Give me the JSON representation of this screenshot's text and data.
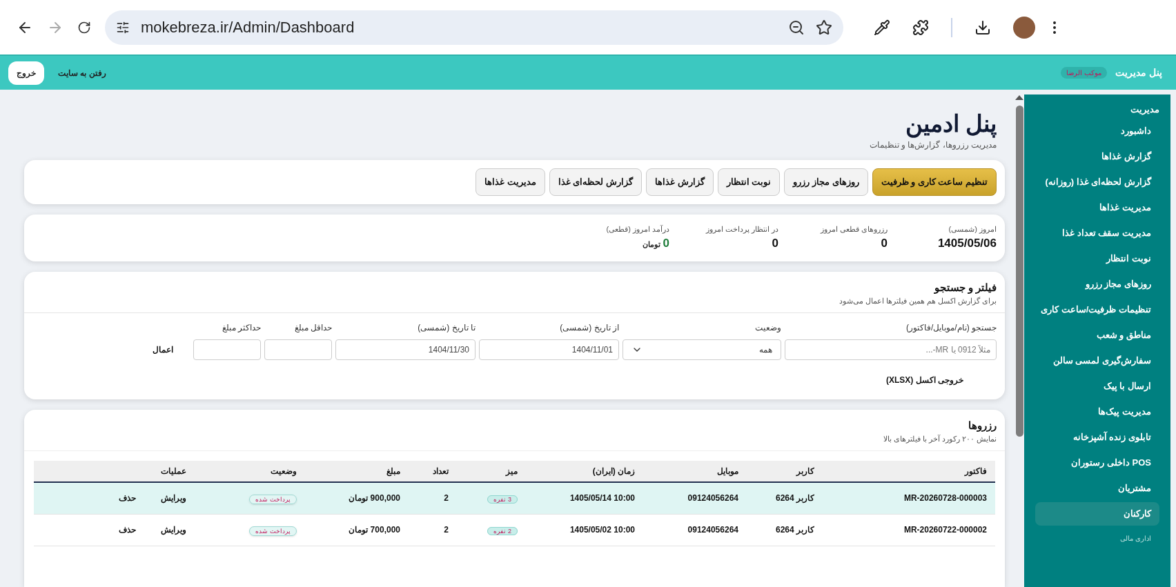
{
  "browser": {
    "url": "mokebreza.ir/Admin/Dashboard"
  },
  "topbar": {
    "title": "پنل مدیریت",
    "badge": "موکب الرضا",
    "site_link": "رفتن به سایت",
    "logout": "خروج"
  },
  "page": {
    "title": "پنل ادمین",
    "subtitle": "مدیریت رزروها، گزارش‌ها و تنظیمات"
  },
  "tabs": [
    {
      "label": "تنظیم ساعت کاری و ظرفیت",
      "selected": true
    },
    {
      "label": "روزهای مجاز رزرو",
      "selected": false
    },
    {
      "label": "نوبت انتظار",
      "selected": false
    },
    {
      "label": "گزارش غذاها",
      "selected": false
    },
    {
      "label": "گزارش لحظه‌ای غذا",
      "selected": false
    },
    {
      "label": "مدیریت غذاها",
      "selected": false
    }
  ],
  "stats": [
    {
      "label": "امروز (شمسی)",
      "value": "1405/05/06",
      "kind": "plain"
    },
    {
      "label": "رزروهای قطعی امروز",
      "value": "0",
      "kind": "plain"
    },
    {
      "label": "در انتظار پرداخت امروز",
      "value": "0",
      "kind": "plain"
    },
    {
      "label": "درآمد امروز (قطعی)",
      "value": "0",
      "unit": "تومان",
      "kind": "money"
    }
  ],
  "filter": {
    "title": "فیلتر و جستجو",
    "subtitle": "برای گزارش اکسل هم همین فیلترها اعمال می‌شود",
    "fields": [
      {
        "label": "جستجو (نام/موبایل/فاکتور)",
        "placeholder": "مثلاً 0912 یا MR-...",
        "kind": "text"
      },
      {
        "label": "وضعیت",
        "value": "همه",
        "kind": "select"
      },
      {
        "label": "از تاریخ (شمسی)",
        "value": "1404/11/01",
        "kind": "text"
      },
      {
        "label": "تا تاریخ (شمسی)",
        "value": "1404/11/30",
        "kind": "text"
      },
      {
        "label": "حداقل مبلغ",
        "kind": "small"
      },
      {
        "label": "حداکثر مبلغ",
        "kind": "small"
      }
    ],
    "apply": "اعمال",
    "export": "خروجی اکسل (XLSX)"
  },
  "reservations": {
    "title": "رزروها",
    "subtitle": "نمایش ۲۰۰ رکورد آخر با فیلترهای بالا",
    "columns": [
      "فاکتور",
      "کاربر",
      "موبایل",
      "زمان (ایران)",
      "میز",
      "تعداد",
      "مبلغ",
      "وضعیت",
      "عملیات"
    ],
    "rows": [
      {
        "selected": true,
        "invoice": "MR-20260728-000003",
        "user": "کاربر 6264",
        "mobile": "09124056264",
        "time": "10:00 1405/05/14",
        "table": "3 نفره",
        "count": "2",
        "amount": "900,000 تومان",
        "status": "پرداخت شده",
        "edit": "ویرایش",
        "delete": "حذف"
      },
      {
        "selected": false,
        "invoice": "MR-20260722-000002",
        "user": "کاربر 6264",
        "mobile": "09124056264",
        "time": "10:00 1405/05/02",
        "table": "2 نفره",
        "count": "2",
        "amount": "700,000 تومان",
        "status": "پرداخت شده",
        "edit": "ویرایش",
        "delete": "حذف"
      }
    ]
  },
  "sidebar": {
    "title": "مدیریت",
    "items": [
      {
        "label": "داشبورد",
        "selected": false
      },
      {
        "label": "گزارش غذاها",
        "selected": false
      },
      {
        "label": "گزارش لحظه‌ای غذا (روزانه)",
        "selected": false
      },
      {
        "label": "مدیریت غذاها",
        "selected": false
      },
      {
        "label": "مدیریت سقف تعداد غذا",
        "selected": false
      },
      {
        "label": "نوبت انتظار",
        "selected": false
      },
      {
        "label": "روزهای مجاز رزرو",
        "selected": false
      },
      {
        "label": "تنظیمات ظرفیت/ساعت کاری",
        "selected": false
      },
      {
        "label": "مناطق و شعب",
        "selected": false
      },
      {
        "label": "سفارش‌گیری لمسی سالن",
        "selected": false
      },
      {
        "label": "ارسال با پیک",
        "selected": false
      },
      {
        "label": "مدیریت پیک‌ها",
        "selected": false
      },
      {
        "label": "تابلوی زنده آشپزخانه",
        "selected": false
      },
      {
        "label": "POS داخلی رستوران",
        "selected": false
      },
      {
        "label": "مشتریان",
        "selected": false
      },
      {
        "label": "کارکنان",
        "selected": true
      }
    ],
    "section": "اداری مالی"
  }
}
